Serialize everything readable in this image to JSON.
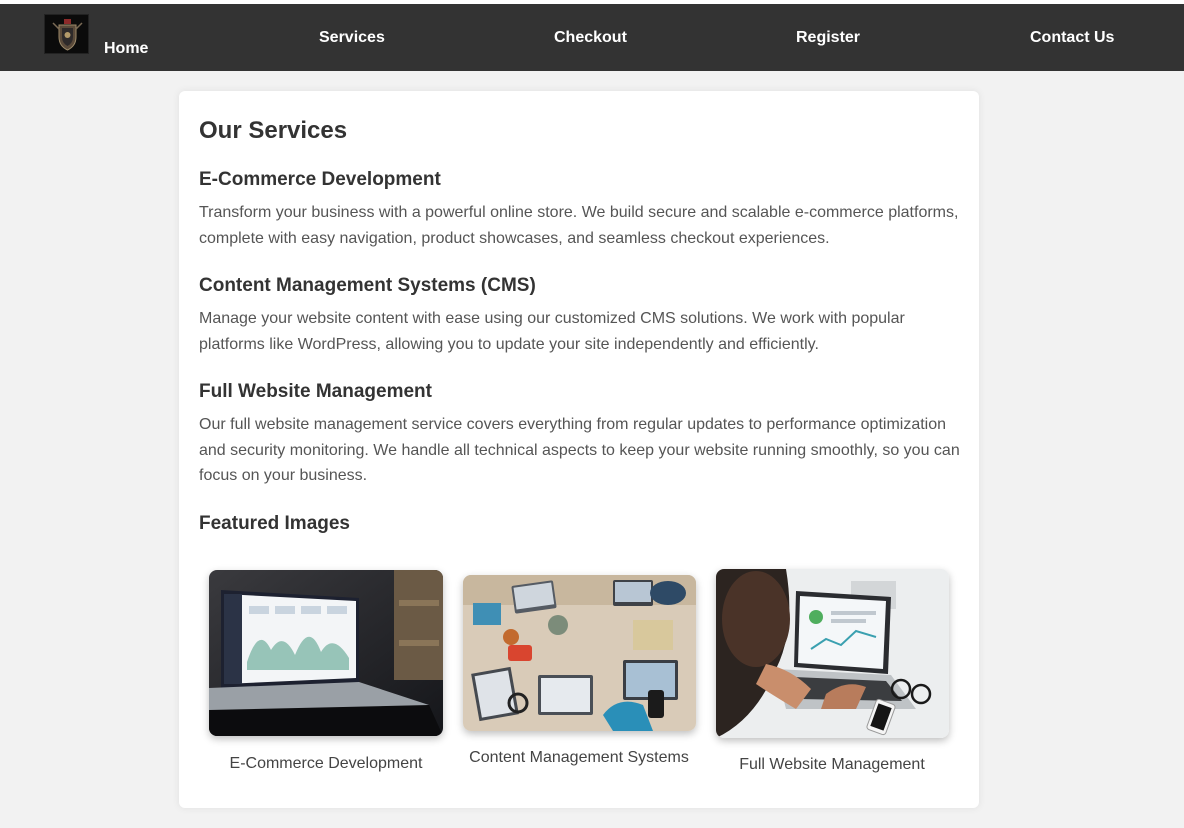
{
  "nav": {
    "home": "Home",
    "services": "Services",
    "checkout": "Checkout",
    "register": "Register",
    "contact": "Contact Us"
  },
  "main": {
    "title": "Our Services",
    "services": [
      {
        "heading": "E-Commerce Development",
        "text": "Transform your business with a powerful online store. We build secure and scalable e-commerce platforms, complete with easy navigation, product showcases, and seamless checkout experiences."
      },
      {
        "heading": "Content Management Systems (CMS)",
        "text": "Manage your website content with ease using our customized CMS solutions. We work with popular platforms like WordPress, allowing you to update your site independently and efficiently."
      },
      {
        "heading": "Full Website Management",
        "text": "Our full website management service covers everything from regular updates to performance optimization and security monitoring. We handle all technical aspects to keep your website running smoothly, so you can focus on your business."
      }
    ],
    "featured_title": "Featured Images",
    "featured": [
      {
        "caption": "E-Commerce Development",
        "icon": "laptop-analytics-photo"
      },
      {
        "caption": "Content Management Systems",
        "icon": "team-desk-photo"
      },
      {
        "caption": "Full Website Management",
        "icon": "person-laptop-photo"
      }
    ]
  },
  "colors": {
    "nav_bg": "#333333",
    "page_bg": "#f2f2f2",
    "card_bg": "#ffffff"
  }
}
